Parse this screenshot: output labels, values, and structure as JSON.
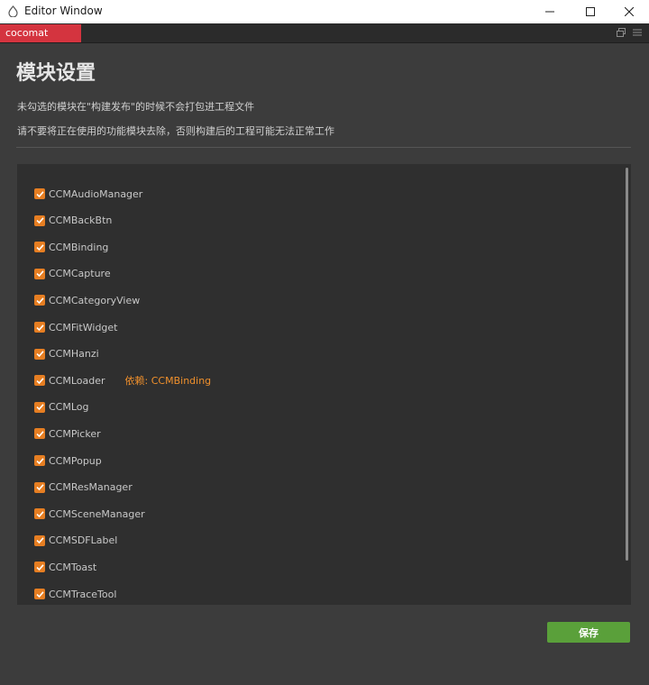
{
  "window": {
    "title": "Editor Window",
    "controls": [
      "minimize",
      "maximize",
      "close"
    ]
  },
  "tab": {
    "label": "cocomat",
    "color": "#d4343f"
  },
  "panel": {
    "heading": "模块设置",
    "description_1": "未勾选的模块在\"构建发布\"的时候不会打包进工程文件",
    "description_2": "请不要将正在使用的功能模块去除，否则构建后的工程可能无法正常工作"
  },
  "modules": [
    {
      "name": "CCMAudioManager",
      "checked": true,
      "dependency": ""
    },
    {
      "name": "CCMBackBtn",
      "checked": true,
      "dependency": ""
    },
    {
      "name": "CCMBinding",
      "checked": true,
      "dependency": ""
    },
    {
      "name": "CCMCapture",
      "checked": true,
      "dependency": ""
    },
    {
      "name": "CCMCategoryView",
      "checked": true,
      "dependency": ""
    },
    {
      "name": "CCMFitWidget",
      "checked": true,
      "dependency": ""
    },
    {
      "name": "CCMHanzi",
      "checked": true,
      "dependency": ""
    },
    {
      "name": "CCMLoader",
      "checked": true,
      "dependency": "依赖: CCMBinding"
    },
    {
      "name": "CCMLog",
      "checked": true,
      "dependency": ""
    },
    {
      "name": "CCMPicker",
      "checked": true,
      "dependency": ""
    },
    {
      "name": "CCMPopup",
      "checked": true,
      "dependency": ""
    },
    {
      "name": "CCMResManager",
      "checked": true,
      "dependency": ""
    },
    {
      "name": "CCMSceneManager",
      "checked": true,
      "dependency": ""
    },
    {
      "name": "CCMSDFLabel",
      "checked": true,
      "dependency": ""
    },
    {
      "name": "CCMToast",
      "checked": true,
      "dependency": ""
    },
    {
      "name": "CCMTraceTool",
      "checked": true,
      "dependency": ""
    }
  ],
  "actions": {
    "save_label": "保存"
  },
  "colors": {
    "checkbox": "#e67e22",
    "dependency_text": "#f0902c",
    "save_button": "#5aa03a"
  }
}
